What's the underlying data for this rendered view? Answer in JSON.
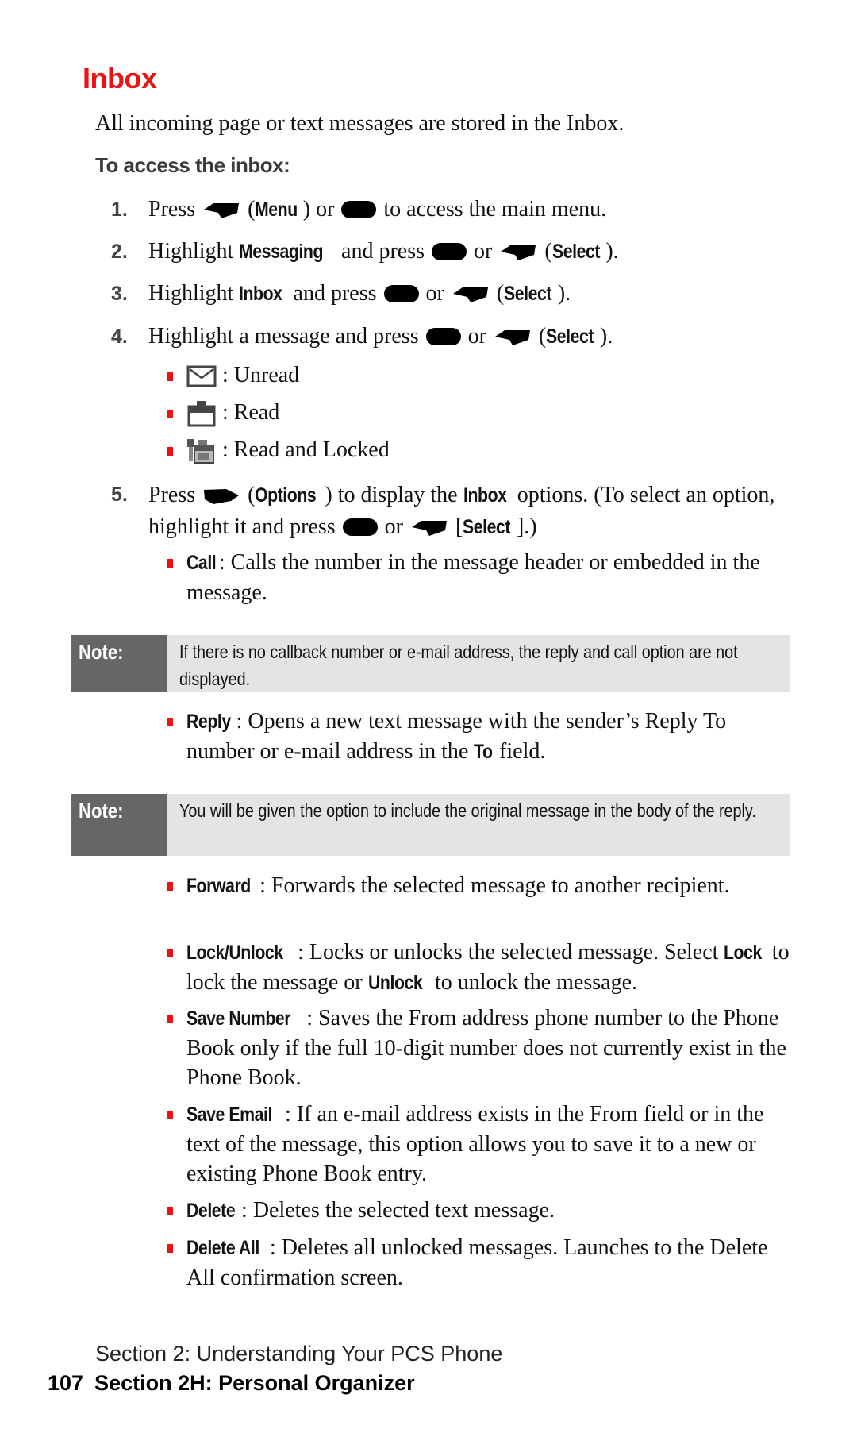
{
  "page": {
    "title": "Inbox",
    "intro": "All incoming page or text messages are stored in the Inbox.",
    "subhead": "To access the inbox:"
  },
  "colors": {
    "accent": "#ee1111",
    "note_label_bg": "#666666",
    "note_body_bg": "#e4e4e4"
  },
  "steps": [
    {
      "num": "1.",
      "parts": {
        "a": "Press",
        "b": "Menu",
        "c": "or",
        "d": "to access the main menu."
      }
    },
    {
      "num": "2.",
      "parts": {
        "a": "Highlight",
        "b": "Messaging",
        "c": "and press",
        "d": "or",
        "e": "Select"
      }
    },
    {
      "num": "3.",
      "parts": {
        "a": "Highlight",
        "b": "Inbox",
        "c": "and press",
        "d": "or",
        "e": "Select"
      }
    },
    {
      "num": "4.",
      "parts": {
        "a": "Highlight a message and press",
        "b": "or",
        "c": "Select"
      }
    },
    {
      "num": "5.",
      "parts": {
        "a": "Press",
        "b": "Options",
        "c": "to display the",
        "d": "Inbox",
        "e": "options. (To select an option, highlight it and press",
        "f": "or",
        "g": "Select"
      }
    }
  ],
  "status_icons": [
    {
      "icon": "envelope-closed-icon",
      "label": ": Unread"
    },
    {
      "icon": "envelope-open-icon",
      "label": ": Read"
    },
    {
      "icon": "envelope-locked-icon",
      "label": ": Read and Locked"
    }
  ],
  "options": [
    {
      "name": "Call",
      "desc": ": Calls the number in the message header or embedded in the message."
    },
    {
      "name": "Reply",
      "desc_a": ": Opens a new text message with the sender’s Reply To number or e-mail address in the",
      "desc_kw": "To",
      "desc_b": "field."
    },
    {
      "name": "Forward",
      "desc": ": Forwards the selected message to another recipient."
    },
    {
      "name": "Lock/Unlock",
      "desc_a": ": Locks or unlocks the selected message. Select",
      "kw1": "Lock",
      "desc_b": "to lock the message or",
      "kw2": "Unlock",
      "desc_c": "to unlock the message."
    },
    {
      "name": "Save Number",
      "desc": ": Saves the From address phone number to the Phone Book only if the full 10-digit number does not currently exist in the Phone Book."
    },
    {
      "name": "Save Email",
      "desc": ": If an e-mail address exists in the From field or in the text of the message, this option allows you to save it to a new or existing Phone Book entry."
    },
    {
      "name": "Delete",
      "desc": ": Deletes the selected text message."
    },
    {
      "name": "Delete All",
      "desc": ": Deletes all unlocked messages. Launches to the Delete All confirmation screen."
    }
  ],
  "notes": [
    {
      "label": "Note:",
      "text": "If there is no callback number or e-mail address, the reply and call option are not displayed."
    },
    {
      "label": "Note:",
      "text": "You will be given the option to include the original message in the body of the reply."
    }
  ],
  "footer": {
    "section": "Section 2: Understanding Your PCS Phone",
    "page_number": "107",
    "subsection": "Section 2H: Personal Organizer"
  }
}
